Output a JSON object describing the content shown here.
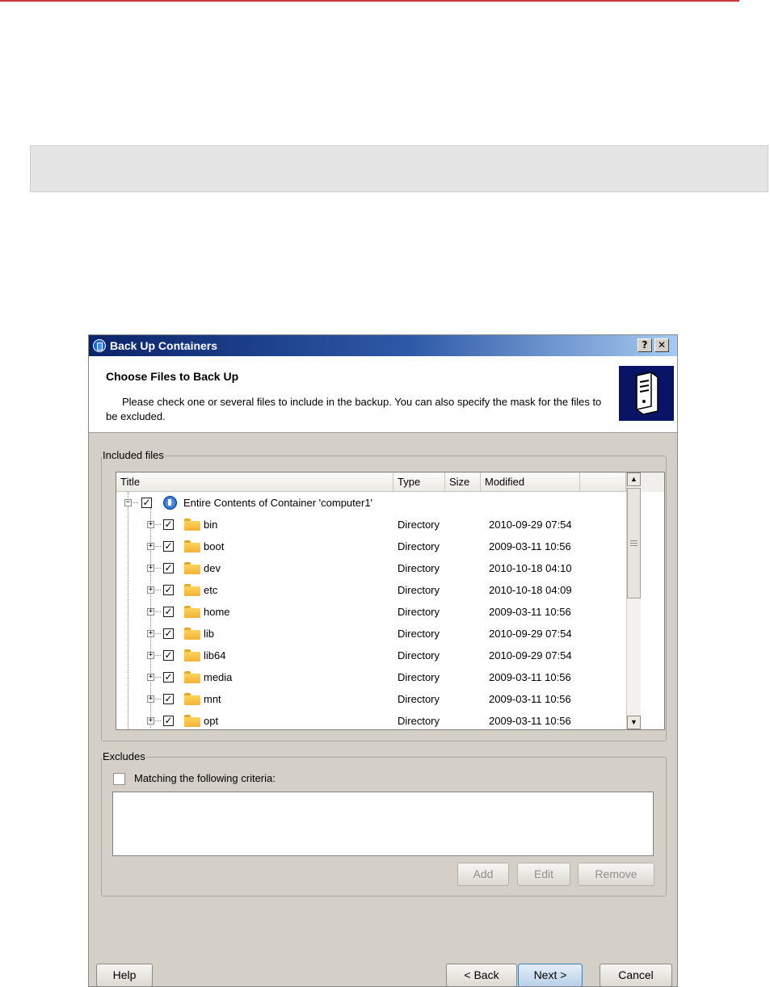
{
  "dialog": {
    "title": "Back Up Containers",
    "help_button": "?",
    "close_button": "✕"
  },
  "header": {
    "title": "Choose Files to Back Up",
    "description": "Please check one or several files to include in the backup. You can also specify the mask for the files to be excluded."
  },
  "included": {
    "label": "Included files",
    "columns": [
      "Title",
      "Type",
      "Size",
      "Modified"
    ],
    "root": {
      "title": "Entire Contents of Container 'computer1'",
      "checked": true,
      "expanded": true
    },
    "rows": [
      {
        "title": "bin",
        "type": "Directory",
        "size": "",
        "modified": "2010-09-29 07:54",
        "checked": true
      },
      {
        "title": "boot",
        "type": "Directory",
        "size": "",
        "modified": "2009-03-11 10:56",
        "checked": true
      },
      {
        "title": "dev",
        "type": "Directory",
        "size": "",
        "modified": "2010-10-18 04:10",
        "checked": true
      },
      {
        "title": "etc",
        "type": "Directory",
        "size": "",
        "modified": "2010-10-18 04:09",
        "checked": true
      },
      {
        "title": "home",
        "type": "Directory",
        "size": "",
        "modified": "2009-03-11 10:56",
        "checked": true
      },
      {
        "title": "lib",
        "type": "Directory",
        "size": "",
        "modified": "2010-09-29 07:54",
        "checked": true
      },
      {
        "title": "lib64",
        "type": "Directory",
        "size": "",
        "modified": "2010-09-29 07:54",
        "checked": true
      },
      {
        "title": "media",
        "type": "Directory",
        "size": "",
        "modified": "2009-03-11 10:56",
        "checked": true
      },
      {
        "title": "mnt",
        "type": "Directory",
        "size": "",
        "modified": "2009-03-11 10:56",
        "checked": true
      },
      {
        "title": "opt",
        "type": "Directory",
        "size": "",
        "modified": "2009-03-11 10:56",
        "checked": true
      }
    ]
  },
  "excludes": {
    "label": "Excludes",
    "criteria_label": "Matching the following criteria:",
    "criteria_checked": false,
    "add": "Add",
    "edit": "Edit",
    "remove": "Remove"
  },
  "footer": {
    "help": "Help",
    "back": "< Back",
    "next": "Next >",
    "cancel": "Cancel"
  },
  "colors": {
    "page_accent_line": "#c8363a",
    "title_bar": "#0a246a",
    "dialog_face": "#d4d0c8"
  },
  "icons": {
    "title": "container-icon",
    "header": "server-icon",
    "folder": "folder-icon",
    "root": "container-icon"
  }
}
